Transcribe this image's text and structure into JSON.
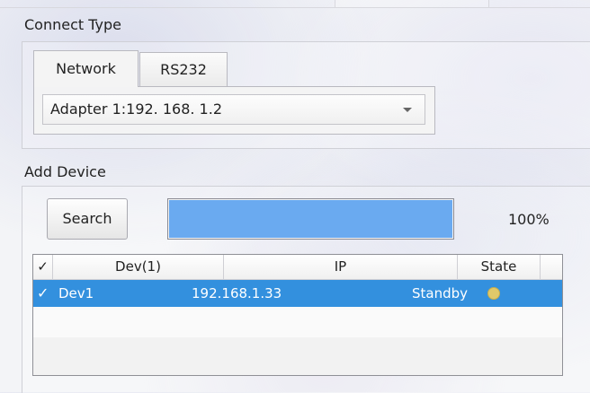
{
  "connect": {
    "label": "Connect Type",
    "tabs": [
      {
        "label": "Network",
        "active": true
      },
      {
        "label": "RS232",
        "active": false
      }
    ],
    "adapter": "Adapter 1:192. 168. 1.2"
  },
  "add": {
    "label": "Add Device",
    "search_label": "Search",
    "progress_percent": 100,
    "progress_text": "100%"
  },
  "table": {
    "headers": {
      "check": "✓",
      "dev": "Dev(1)",
      "ip": "IP",
      "state": "State"
    },
    "rows": [
      {
        "checked": "✓",
        "name": "Dev1",
        "ip": "192.168.1.33",
        "state": "Standby",
        "selected": true
      }
    ]
  },
  "colors": {
    "selection": "#3390de",
    "progress_fill": "#6aaaf0",
    "status_dot": "#e0c96a"
  }
}
